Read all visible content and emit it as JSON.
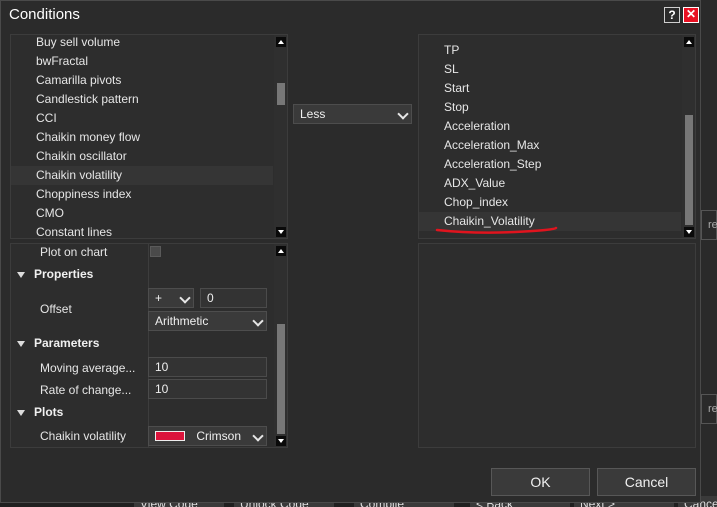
{
  "dialog": {
    "title": "Conditions",
    "help_label": "?",
    "close_label": "✕"
  },
  "indicator_list": {
    "items": [
      "Buy sell volume",
      "bwFractal",
      "Camarilla pivots",
      "Candlestick pattern",
      "CCI",
      "Chaikin money flow",
      "Chaikin oscillator",
      "Chaikin volatility",
      "Choppiness index",
      "CMO",
      "Constant lines"
    ],
    "selected": "Chaikin volatility"
  },
  "operator": {
    "value": "Less"
  },
  "variable_list": {
    "items": [
      "TP",
      "SL",
      "Start",
      "Stop",
      "Acceleration",
      "Acceleration_Max",
      "Acceleration_Step",
      "ADX_Value",
      "Chop_index",
      "Chaikin_Volatility"
    ],
    "selected": "Chaikin_Volatility",
    "annotation_color": "#e0141e"
  },
  "properties_panel": {
    "plot_on_chart_label": "Plot on chart",
    "properties_header": "Properties",
    "offset_label": "Offset",
    "offset_sign": "+",
    "offset_value": "0",
    "offset_type": "Arithmetic",
    "parameters_header": "Parameters",
    "moving_average_label": "Moving average...",
    "moving_average_value": "10",
    "rate_of_change_label": "Rate of change...",
    "rate_of_change_value": "10",
    "plots_header": "Plots",
    "chaikin_volatility_label": "Chaikin volatility",
    "plot_color_name": "Crimson",
    "plot_color": "#dc143c"
  },
  "buttons": {
    "ok": "OK",
    "cancel": "Cancel"
  },
  "background": {
    "bottom_buttons": [
      "View Code",
      "Unlock Code",
      "Compile",
      "< Back",
      "Next >",
      "Cancel"
    ],
    "right_fields": [
      "re",
      "re"
    ]
  }
}
